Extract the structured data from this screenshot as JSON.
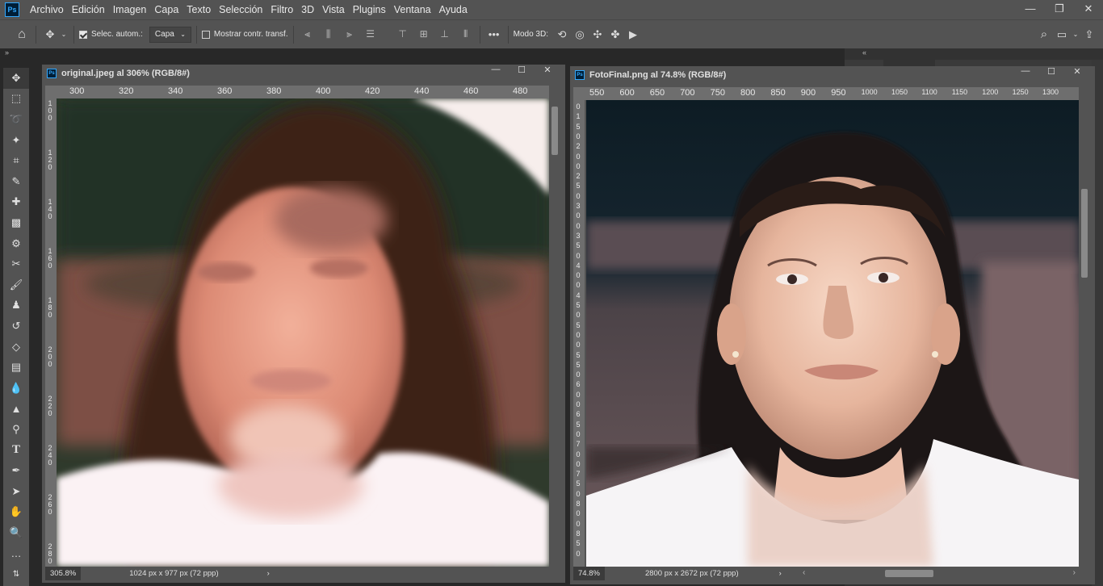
{
  "menubar": {
    "logo": "Ps",
    "items": [
      "Archivo",
      "Edición",
      "Imagen",
      "Capa",
      "Texto",
      "Selección",
      "Filtro",
      "3D",
      "Vista",
      "Plugins",
      "Ventana",
      "Ayuda"
    ]
  },
  "options": {
    "auto_select_label": "Selec. autom.:",
    "layer_dropdown": "Capa",
    "show_transform_label": "Mostrar contr. transf.",
    "more": "•••",
    "mode3d_label": "Modo 3D:"
  },
  "doc1": {
    "title": "original.jpeg al 306% (RGB/8#)",
    "ruler_h": [
      "300",
      "320",
      "340",
      "360",
      "380",
      "400",
      "420",
      "440",
      "460",
      "480"
    ],
    "ruler_v": [
      [
        "1",
        "0",
        "0"
      ],
      [
        "1",
        "2",
        "0"
      ],
      [
        "1",
        "4",
        "0"
      ],
      [
        "1",
        "6",
        "0"
      ],
      [
        "1",
        "8",
        "0"
      ],
      [
        "2",
        "0",
        "0"
      ],
      [
        "2",
        "2",
        "0"
      ],
      [
        "2",
        "4",
        "0"
      ],
      [
        "2",
        "6",
        "0"
      ],
      [
        "2",
        "8",
        "0"
      ]
    ],
    "zoom": "305.8%",
    "info": "1024 px x 977 px (72 ppp)"
  },
  "doc2": {
    "title": "FotoFinal.png al 74.8% (RGB/8#)",
    "ruler_h": [
      "550",
      "600",
      "650",
      "700",
      "750",
      "800",
      "850",
      "900",
      "950",
      "1000",
      "1050",
      "1100",
      "1150",
      "1200",
      "1250",
      "1300"
    ],
    "ruler_v": [
      "0",
      "1",
      "5",
      "0",
      "2",
      "0",
      "0",
      "2",
      "5",
      "0",
      "3",
      "0",
      "0",
      "3",
      "5",
      "0",
      "4",
      "0",
      "0",
      "4",
      "5",
      "0",
      "5",
      "0",
      "0",
      "5",
      "5",
      "0",
      "6",
      "0",
      "0",
      "6",
      "5",
      "0",
      "7",
      "0",
      "0",
      "7",
      "5",
      "0",
      "8",
      "0",
      "0",
      "8",
      "5",
      "0"
    ],
    "zoom": "74.8%",
    "info": "2800 px x 2672 px (72 ppp)"
  },
  "colors": {
    "accent": "#31a8ff",
    "panel": "#535353",
    "ruler": "#6e6e6e"
  }
}
